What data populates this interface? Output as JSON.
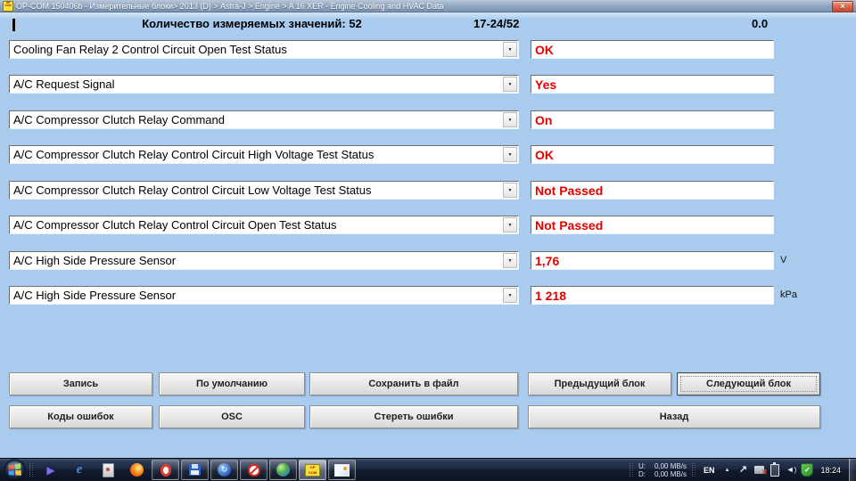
{
  "window": {
    "title": "OP-COM 150406b - Измерительные блоки> 2013 (D) > Astra-J > Engine > A 16 XER - Engine Cooling and HVAC Data",
    "app_icon_label": "OP COM"
  },
  "header": {
    "measured_values_label": "Количество измеряемых значений: 52",
    "block_range": "17-24/52",
    "timer": "0.0"
  },
  "rows": [
    {
      "param": "Cooling Fan Relay 2 Control Circuit Open Test Status",
      "value": "OK",
      "unit": ""
    },
    {
      "param": "A/C Request Signal",
      "value": "Yes",
      "unit": ""
    },
    {
      "param": "A/C Compressor Clutch Relay Command",
      "value": "On",
      "unit": ""
    },
    {
      "param": "A/C Compressor Clutch Relay Control Circuit High Voltage Test Status",
      "value": "OK",
      "unit": ""
    },
    {
      "param": "A/C Compressor Clutch Relay Control Circuit Low Voltage Test Status",
      "value": "Not Passed",
      "unit": ""
    },
    {
      "param": "A/C Compressor Clutch Relay Control Circuit Open Test Status",
      "value": "Not Passed",
      "unit": ""
    },
    {
      "param": "A/C High Side Pressure Sensor",
      "value": "1,76",
      "unit": "V"
    },
    {
      "param": "A/C High Side Pressure Sensor",
      "value": "1 218",
      "unit": "kPa"
    }
  ],
  "buttons": {
    "row1": [
      {
        "name": "record-button",
        "label": "Запись"
      },
      {
        "name": "default-button",
        "label": "По умолчанию"
      },
      {
        "name": "save-to-file-button",
        "label": "Сохранить в файл"
      },
      {
        "name": "previous-block-button",
        "label": "Предыдущий блок"
      },
      {
        "name": "next-block-button",
        "label": "Следующий блок",
        "focused": true
      }
    ],
    "row2": [
      {
        "name": "trouble-codes-button",
        "label": "Коды ошибок"
      },
      {
        "name": "osc-button",
        "label": "OSC"
      },
      {
        "name": "erase-codes-button",
        "label": "Стереть ошибки"
      },
      {
        "name": "back-button",
        "label": "Назад"
      }
    ]
  },
  "taskbar": {
    "icons": [
      {
        "name": "media-play-icon",
        "running": false
      },
      {
        "name": "internet-explorer-icon",
        "running": false
      },
      {
        "name": "removable-device-icon",
        "running": false
      },
      {
        "name": "firefox-icon",
        "running": false
      },
      {
        "name": "opera-icon",
        "running": true
      },
      {
        "name": "floppy-save-app-icon",
        "running": true
      },
      {
        "name": "sync-app-icon",
        "running": true
      },
      {
        "name": "blocked-sign-app-icon",
        "running": true
      },
      {
        "name": "download-manager-icon",
        "running": true
      },
      {
        "name": "opcom-app-icon",
        "running": true,
        "active": true,
        "label": "OP COM"
      },
      {
        "name": "image-viewer-icon",
        "running": true
      }
    ],
    "tray_icons": [
      "hidden-icons-arrow-icon",
      "remote-arrow-icon",
      "network-error-icon",
      "battery-icon",
      "volume-icon",
      "security-shield-icon"
    ],
    "net": {
      "u_label": "U:",
      "u_value": "0,00 MB/s",
      "d_label": "D:",
      "d_value": "0,00 MB/s"
    },
    "language": "EN",
    "clock": "18:24"
  },
  "colors": {
    "value_text": "#e60000",
    "body_bg": "#a8cbee",
    "taskbar_active_app": "#f4e33c"
  }
}
